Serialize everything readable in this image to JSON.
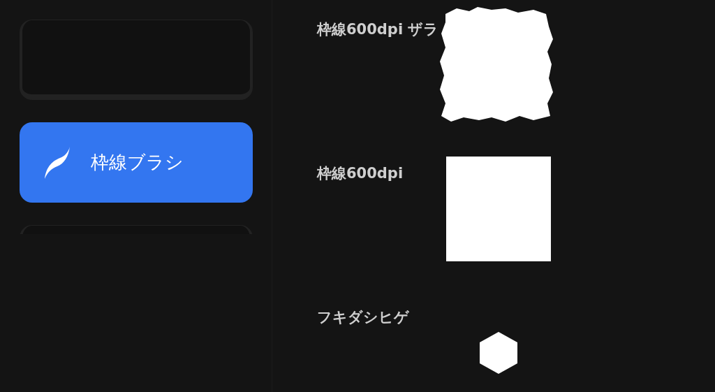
{
  "brush_sets": [
    {
      "selected": false
    },
    {
      "label": "枠線ブラシ",
      "selected": true
    },
    {
      "selected": false
    }
  ],
  "brushes": [
    {
      "name": "枠線600dpi ザラ",
      "kind": "rough"
    },
    {
      "name": "枠線600dpi",
      "kind": "square"
    },
    {
      "name": "フキダシヒゲ",
      "kind": "hexagon"
    }
  ]
}
